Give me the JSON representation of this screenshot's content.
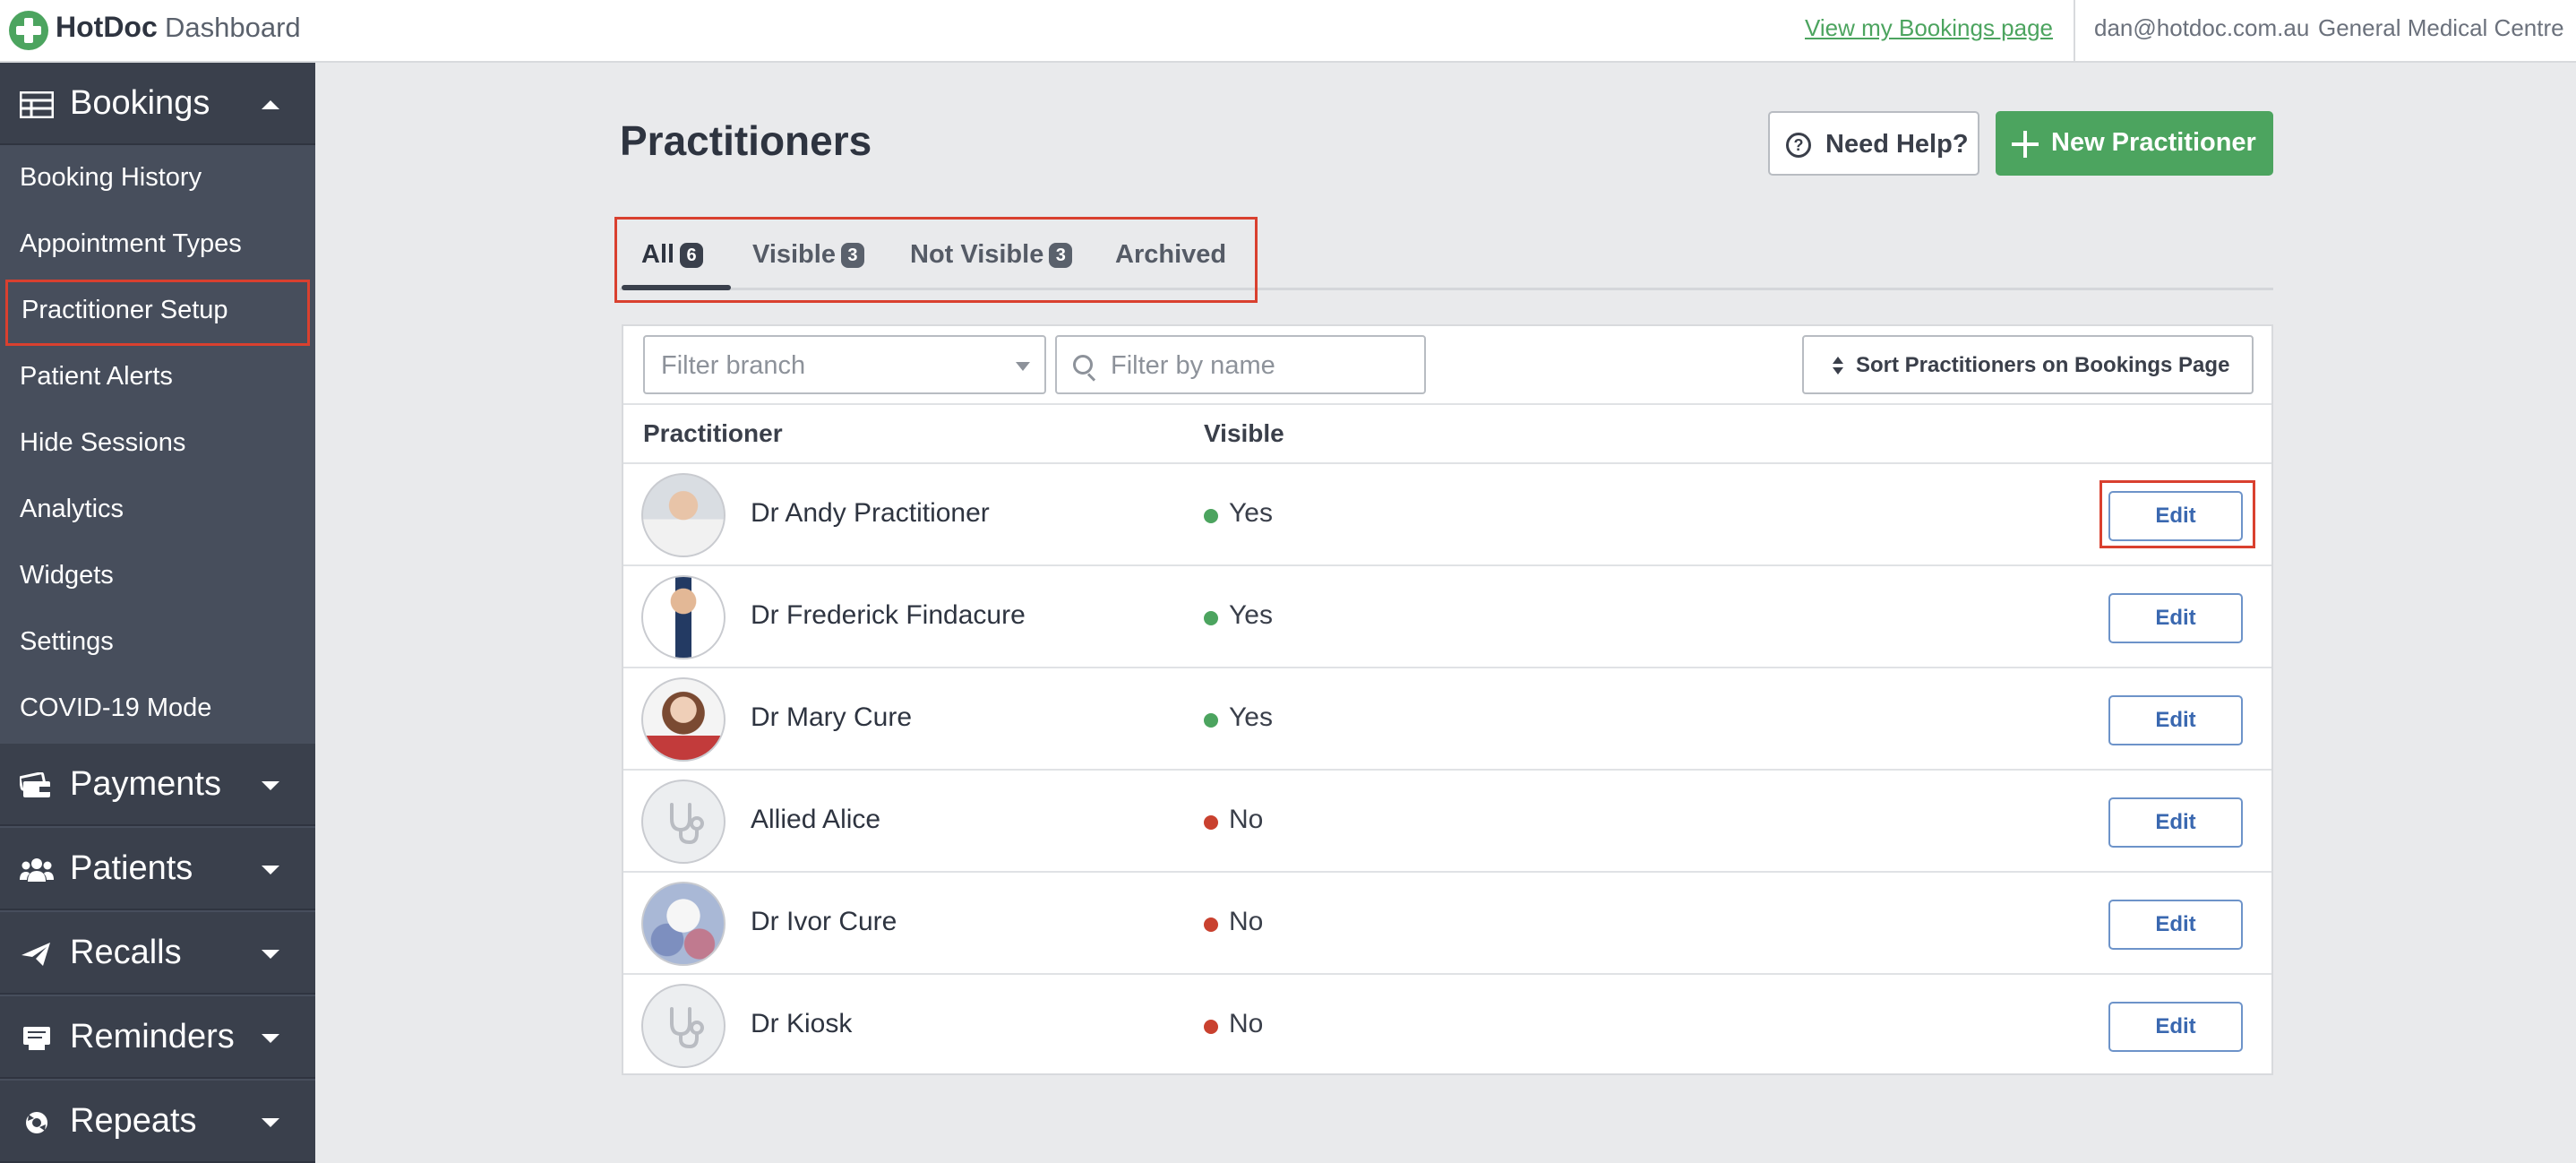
{
  "topbar": {
    "brand": "HotDoc",
    "brand_sub": "Dashboard",
    "view_link": "View my Bookings page",
    "user_email": "dan@hotdoc.com.au",
    "clinic": "General Medical Centre"
  },
  "sidebar": {
    "bookings": {
      "label": "Bookings",
      "icon": "table-icon"
    },
    "items": [
      {
        "label": "Booking History"
      },
      {
        "label": "Appointment Types"
      },
      {
        "label": "Practitioner Setup",
        "active": true
      },
      {
        "label": "Patient Alerts"
      },
      {
        "label": "Hide Sessions"
      },
      {
        "label": "Analytics"
      },
      {
        "label": "Widgets"
      },
      {
        "label": "Settings"
      },
      {
        "label": "COVID-19 Mode"
      }
    ],
    "sections": [
      {
        "label": "Payments",
        "icon": "payments-icon"
      },
      {
        "label": "Patients",
        "icon": "patients-icon"
      },
      {
        "label": "Recalls",
        "icon": "paper-plane-icon"
      },
      {
        "label": "Reminders",
        "icon": "reminders-icon"
      },
      {
        "label": "Repeats",
        "icon": "repeats-icon"
      }
    ]
  },
  "main": {
    "title": "Practitioners",
    "help_label": "Need Help?",
    "new_label": "New Practitioner",
    "tabs": [
      {
        "label": "All",
        "count": "6",
        "active": true
      },
      {
        "label": "Visible",
        "count": "3"
      },
      {
        "label": "Not Visible",
        "count": "3"
      },
      {
        "label": "Archived"
      }
    ],
    "filter_branch_placeholder": "Filter branch",
    "filter_name_placeholder": "Filter by name",
    "sort_label": "Sort Practitioners on Bookings Page",
    "columns": {
      "practitioner": "Practitioner",
      "visible": "Visible"
    },
    "rows": [
      {
        "name": "Dr Andy Practitioner",
        "visible": "Yes",
        "edit": "Edit"
      },
      {
        "name": "Dr Frederick Findacure",
        "visible": "Yes",
        "edit": "Edit"
      },
      {
        "name": "Dr Mary Cure",
        "visible": "Yes",
        "edit": "Edit"
      },
      {
        "name": "Allied Alice",
        "visible": "No",
        "edit": "Edit"
      },
      {
        "name": "Dr Ivor Cure",
        "visible": "No",
        "edit": "Edit"
      },
      {
        "name": "Dr Kiosk",
        "visible": "No",
        "edit": "Edit"
      }
    ]
  },
  "colors": {
    "brand_green": "#4ca45f",
    "sidebar": "#474e5c",
    "highlight": "#d9402f",
    "status_yes": "#4ca45f",
    "status_no": "#c9412f"
  }
}
